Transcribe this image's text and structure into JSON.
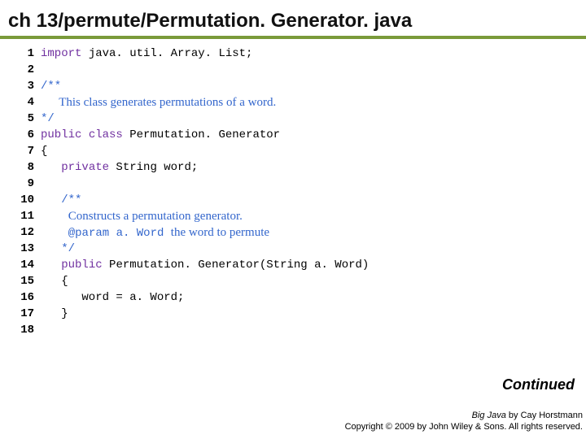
{
  "title": "ch 13/permute/Permutation. Generator. java",
  "gutter": [
    "1",
    "2",
    "3",
    "4",
    "5",
    "6",
    "7",
    "8",
    "9",
    "10",
    "11",
    "12",
    "13",
    "14",
    "15",
    "16",
    "17",
    "18"
  ],
  "code": {
    "l1": {
      "kw1": "import",
      "rest": " java. util. Array. List;"
    },
    "l3": {
      "star": "/**"
    },
    "l4": {
      "text": "      This class generates permutations of a word."
    },
    "l5": {
      "star": "*/"
    },
    "l6": {
      "kw1": "public",
      "kw2": "class",
      "rest": " Permutation. Generator"
    },
    "l7": "{",
    "l8": {
      "indent": "   ",
      "kw1": "private",
      "rest": " String word;"
    },
    "l10": {
      "indent": "   ",
      "star": "/**"
    },
    "l11": {
      "text": "         Constructs a permutation generator."
    },
    "l12a": {
      "indent_text": "         ",
      "tag": "@param",
      "tag2": " a. Word ",
      "text": "the word to permute"
    },
    "l13": {
      "indent": "   ",
      "star": "*/"
    },
    "l14": {
      "indent": "   ",
      "kw1": "public",
      "rest": " Permutation. Generator(String a. Word)"
    },
    "l15": "   {",
    "l16": "      word = a. Word;",
    "l17": "   }"
  },
  "continued": "Continued",
  "footer": {
    "line1a": "Big Java",
    "line1b": " by Cay Horstmann",
    "line2": "Copyright © 2009 by John Wiley & Sons. All rights reserved."
  }
}
